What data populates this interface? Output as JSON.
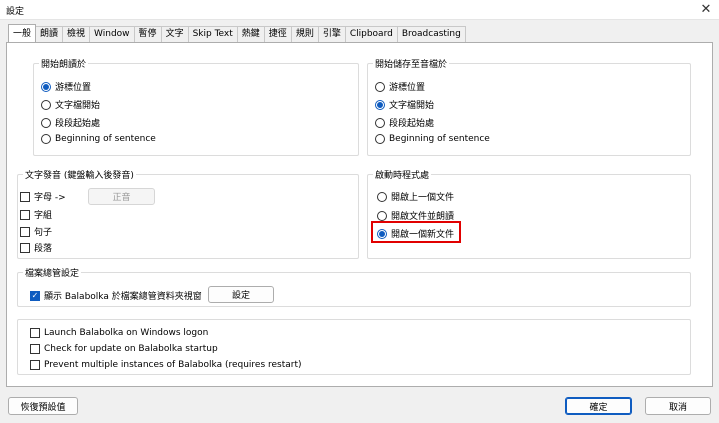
{
  "window": {
    "title": "設定",
    "close_glyph": "✕"
  },
  "tabs": [
    "一般",
    "朗讀",
    "檢視",
    "Window",
    "暫停",
    "文字",
    "Skip Text",
    "熱鍵",
    "捷徑",
    "規則",
    "引擎",
    "Clipboard",
    "Broadcasting"
  ],
  "start_reading": {
    "title": "開始朗讀於",
    "options": [
      "游標位置",
      "文字檔開始",
      "段段起始處",
      "Beginning of sentence"
    ],
    "selected": 0
  },
  "start_saving": {
    "title": "開始儲存至音檔於",
    "options": [
      "游標位置",
      "文字檔開始",
      "段段起始處",
      "Beginning of sentence"
    ],
    "selected": 1
  },
  "text_speech": {
    "title": "文字發音 (鍵盤輸入後發音)",
    "items": [
      "字母 ->",
      "字組",
      "句子",
      "段落"
    ],
    "correct_button": "正音"
  },
  "startup": {
    "title": "啟動時程式處",
    "options": [
      "開啟上一個文件",
      "開啟文件並朗讀",
      "開啟一個新文件"
    ],
    "selected": 2
  },
  "file_manager": {
    "title": "檔案總管設定",
    "checkbox_label": "顯示 Balabolka 於檔案總管資料夾視窗",
    "checked": true,
    "settings_button": "設定"
  },
  "misc": {
    "items": [
      "Launch Balabolka on Windows logon",
      "Check for update on Balabolka startup",
      "Prevent multiple instances of Balabolka (requires restart)"
    ]
  },
  "footer": {
    "restore": "恢復預設值",
    "ok": "確定",
    "cancel": "取消"
  },
  "colors": {
    "accent": "#0f5cc0",
    "highlight": "#e10000"
  }
}
